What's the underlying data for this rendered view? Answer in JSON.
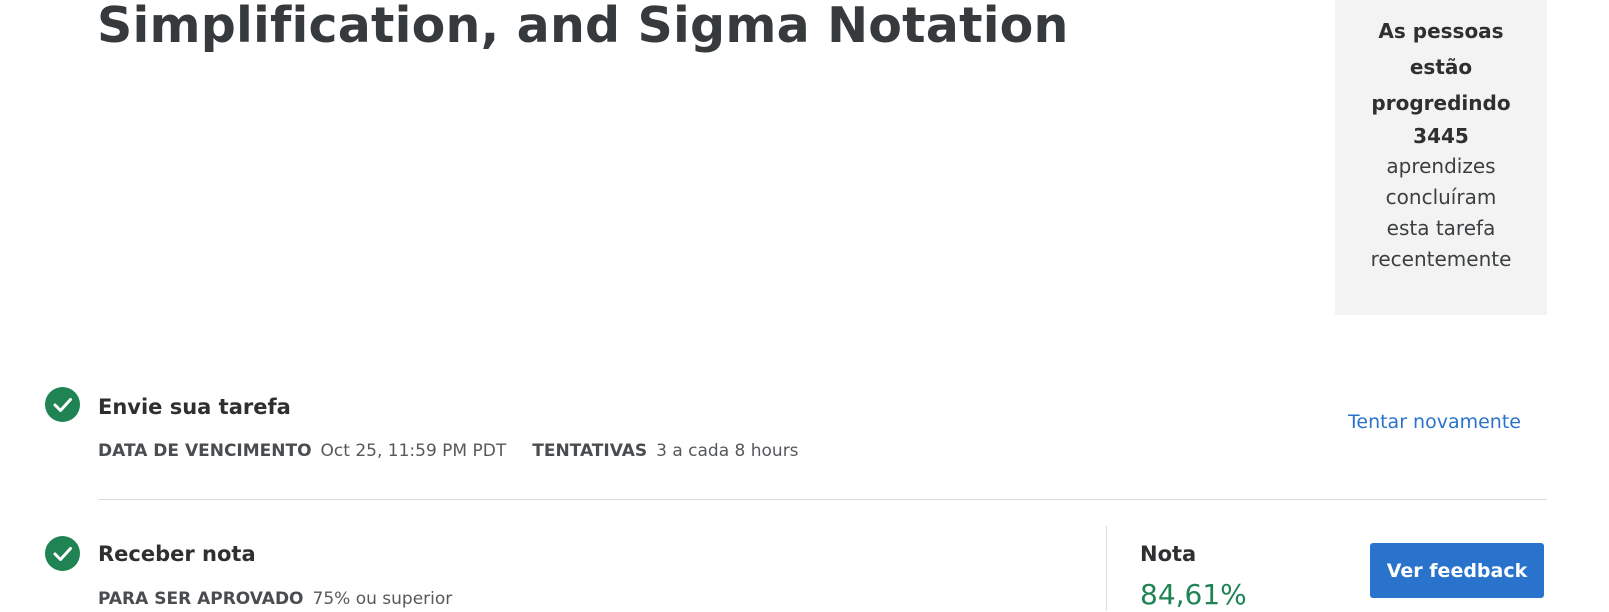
{
  "header": {
    "title": "Simplification, and Sigma Notation"
  },
  "progress_panel": {
    "line1": "As pessoas",
    "line2": "estão",
    "line3": "progredindo",
    "count": "3445",
    "line5": "aprendizes",
    "line6": "concluíram",
    "line7": "esta tarefa",
    "line8": "recentemente"
  },
  "submit_step": {
    "title": "Envie sua tarefa",
    "due_label": "DATA DE VENCIMENTO",
    "due_value": "Oct 25, 11:59 PM PDT",
    "attempts_label": "TENTATIVAS",
    "attempts_value": "3 a cada 8 hours",
    "retry_link": "Tentar novamente"
  },
  "grade_step": {
    "title": "Receber nota",
    "pass_label": "PARA SER APROVADO",
    "pass_value": "75% ou superior",
    "grade_label": "Nota",
    "grade_value": "84,61%",
    "feedback_button": "Ver feedback"
  },
  "colors": {
    "success_green": "#1f8354",
    "link_blue": "#2a73cc",
    "panel_bg": "#f3f3f3"
  },
  "icons": {
    "step_status": "checkmark-circle-icon"
  }
}
